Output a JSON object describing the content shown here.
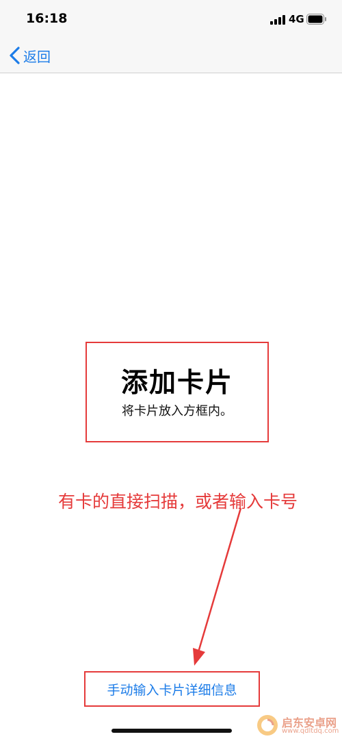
{
  "status_bar": {
    "time": "16:18",
    "network": "4G",
    "icons": [
      "signal-icon",
      "battery-icon"
    ]
  },
  "nav": {
    "back_label": "返回",
    "back_icon": "chevron-left-icon"
  },
  "card_prompt": {
    "title": "添加卡片",
    "subtitle": "将卡片放入方框内。"
  },
  "annotation": {
    "text": "有卡的直接扫描，或者输入卡号",
    "color": "#e53a3a"
  },
  "manual_entry": {
    "label": "手动输入卡片详细信息"
  },
  "watermark": {
    "name": "启东安卓网",
    "url": "www.qdltdq.com"
  },
  "colors": {
    "accent": "#1c7ce8",
    "annotation_red": "#e53a3a",
    "nav_background": "#f7f7f7"
  }
}
